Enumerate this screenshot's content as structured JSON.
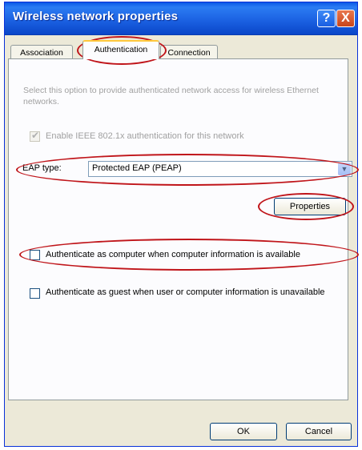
{
  "window": {
    "title": "Wireless network properties"
  },
  "title_buttons": {
    "help": "?",
    "close": "X"
  },
  "tabs": [
    {
      "label": "Association"
    },
    {
      "label": "Authentication"
    },
    {
      "label": "Connection"
    }
  ],
  "auth": {
    "description": "Select this option to provide authenticated network access for wireless Ethernet networks.",
    "enable_8021x": {
      "label": "Enable IEEE 802.1x authentication for this network",
      "checked": true
    },
    "eap_type_label": "EAP type:",
    "eap_type_value": "Protected EAP (PEAP)",
    "properties_label": "Properties",
    "auth_as_computer": {
      "label": "Authenticate as computer when computer information is available",
      "checked": false
    },
    "auth_as_guest": {
      "label": "Authenticate as guest when user or computer information is unavailable",
      "checked": false
    }
  },
  "footer": {
    "ok_label": "OK",
    "cancel_label": "Cancel"
  },
  "annotation_color": "#c0151a"
}
